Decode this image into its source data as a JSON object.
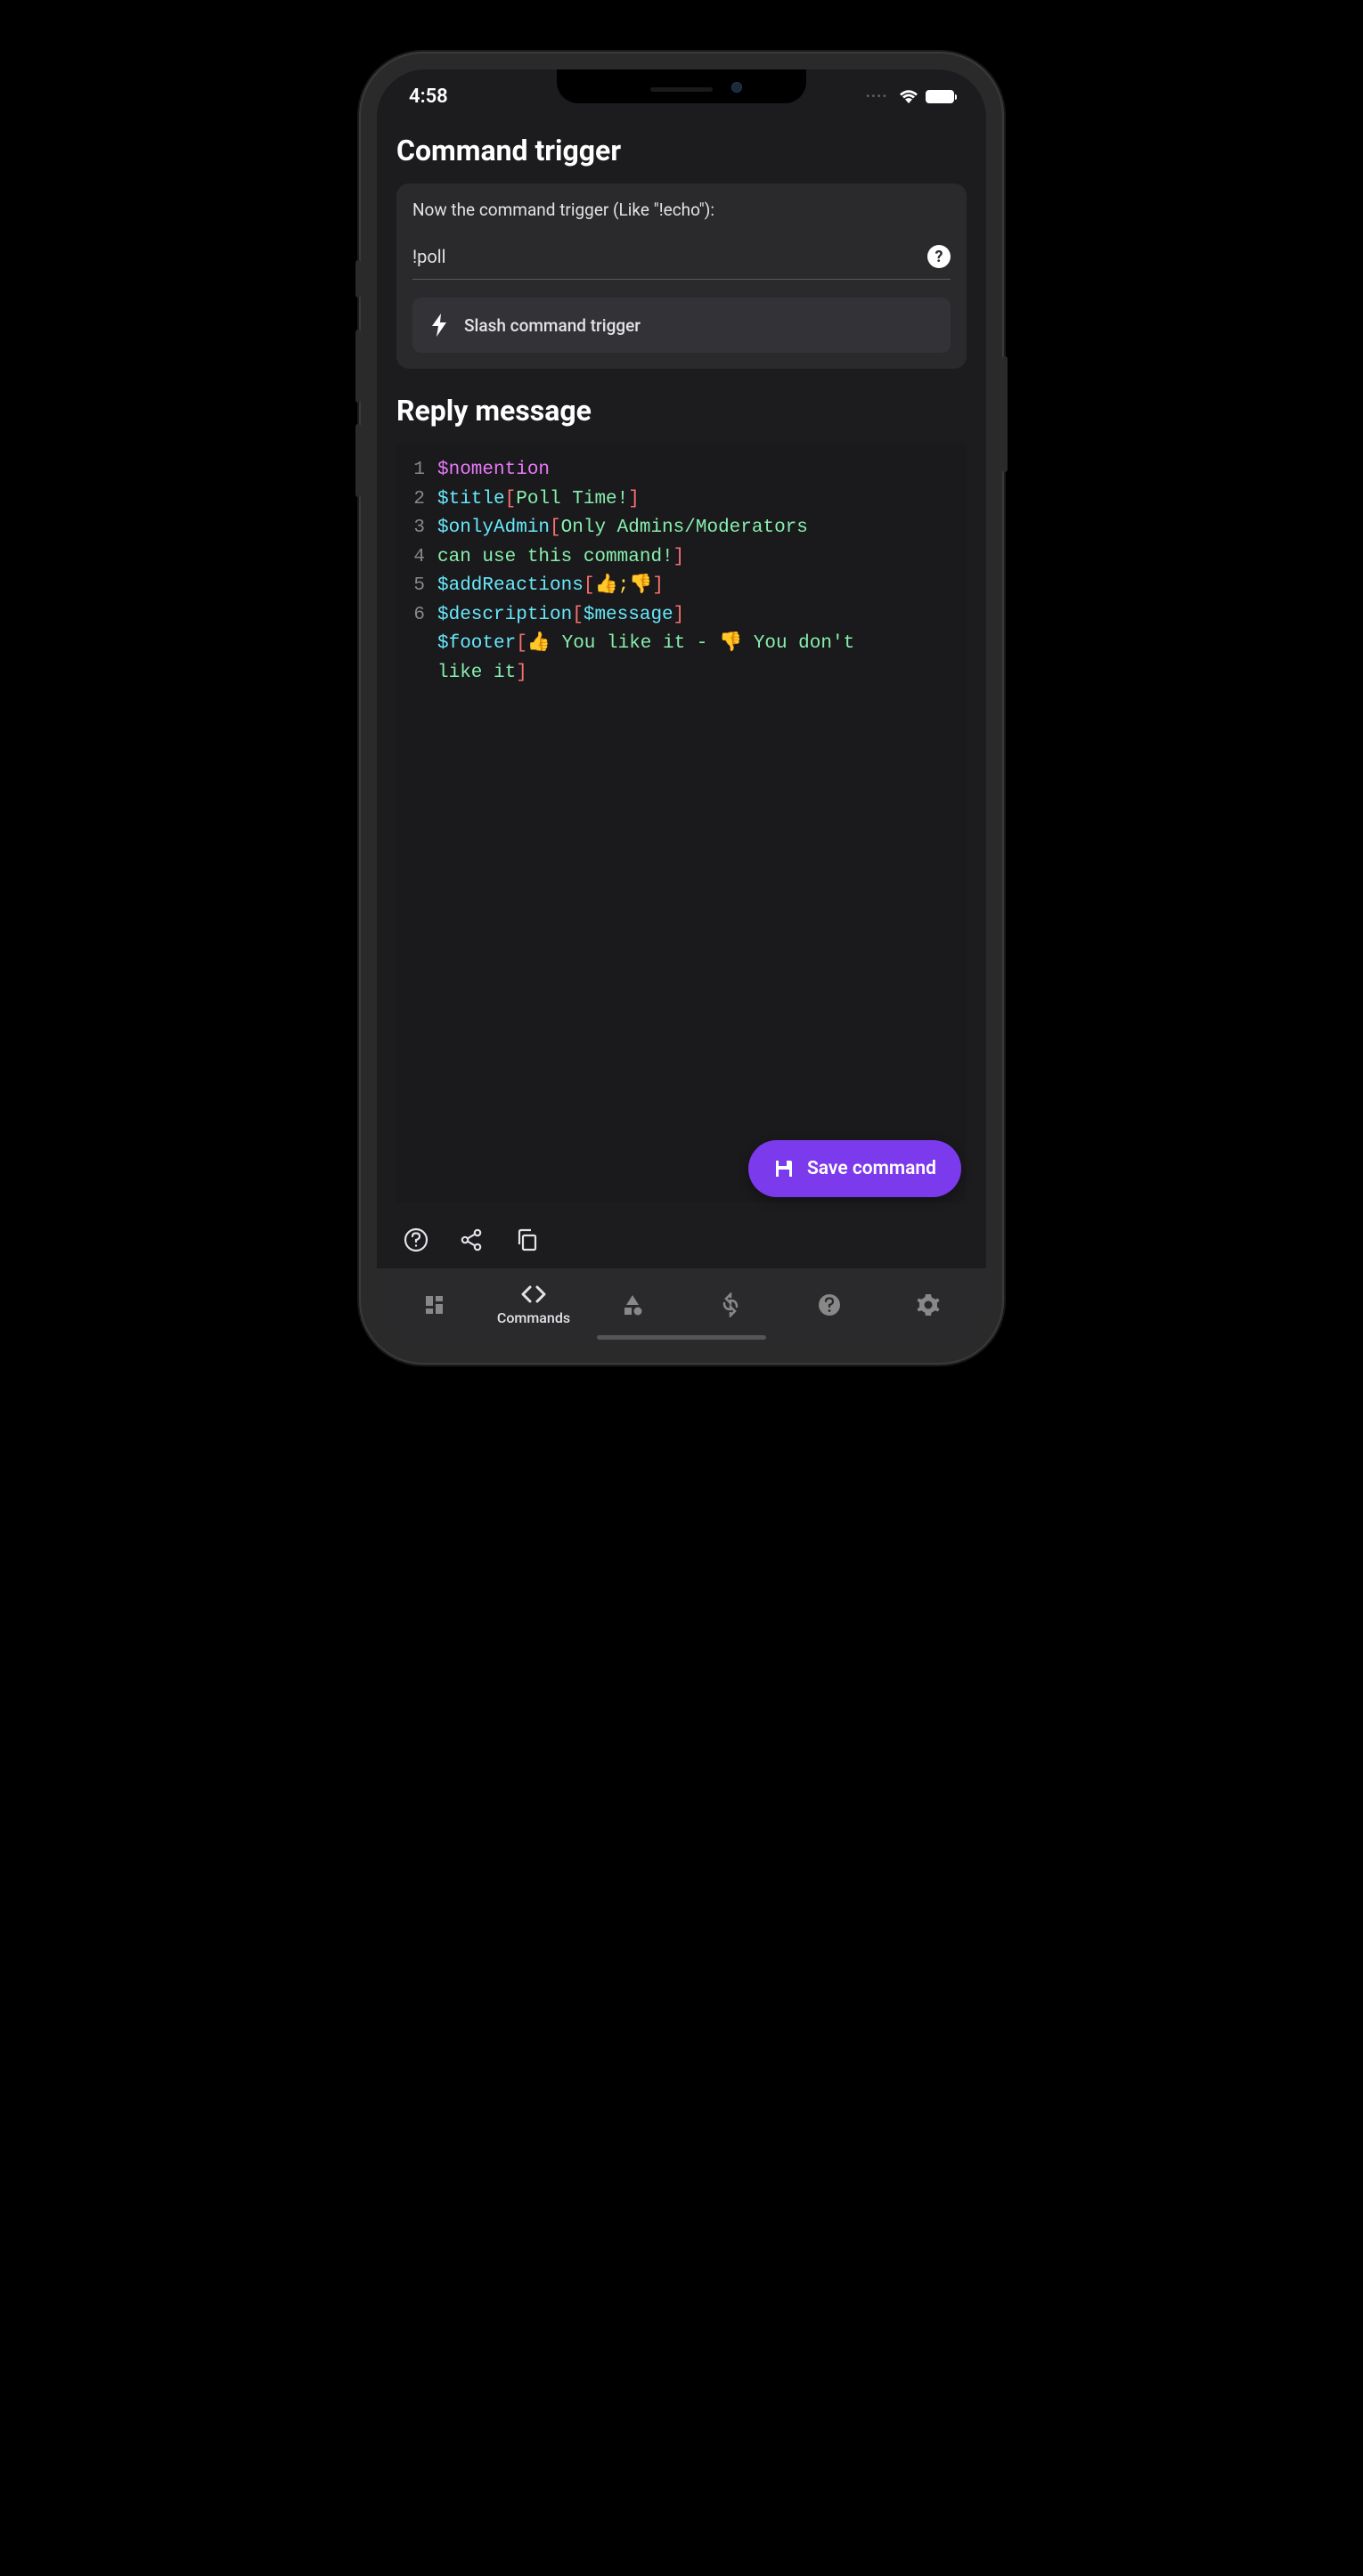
{
  "status": {
    "time": "4:58"
  },
  "trigger_section": {
    "title": "Command trigger",
    "label": "Now the command trigger (Like \"!echo\"):",
    "value": "!poll",
    "slash_button": "Slash command trigger"
  },
  "reply_section": {
    "title": "Reply message",
    "code": {
      "line1": {
        "var": "$nomention"
      },
      "line2": {
        "var": "$title",
        "open": "[",
        "value": "Poll Time!",
        "close": "]"
      },
      "line3": {
        "var": "$onlyAdmin",
        "open": "[",
        "value": "Only Admins/Moderators"
      },
      "line4": {
        "value": "can use this command!",
        "close": "]"
      },
      "line5": {
        "var": "$addReactions",
        "open": "[",
        "v1": "👍",
        "sep": ";",
        "v2": "👎",
        "close": "]"
      },
      "line6": {
        "var": "$description",
        "open": "[",
        "inner": "$message",
        "close": "]"
      },
      "line7": {
        "var": "$footer",
        "open": "[",
        "v1": "👍",
        "t1": " You like it - ",
        "v2": "👎",
        "t2": " You don't"
      },
      "line8": {
        "t1": "like it",
        "close": "]"
      }
    }
  },
  "fab": {
    "label": "Save command"
  },
  "nav": {
    "commands": "Commands"
  }
}
